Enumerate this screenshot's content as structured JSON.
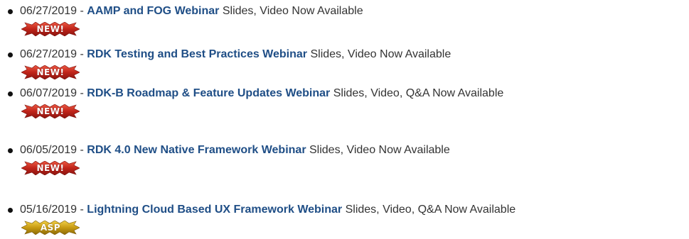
{
  "colors": {
    "link": "#1f4e86",
    "text": "#333333",
    "new_badge": "#c0241a",
    "asp_badge": "#c79a12"
  },
  "items": [
    {
      "date": "06/27/2019",
      "separator": " - ",
      "title": "AAMP and FOG Webinar",
      "suffix": " Slides, Video Now Available",
      "badge": "NEW!",
      "badge_type": "new"
    },
    {
      "date": "06/27/2019",
      "separator": " - ",
      "title": "RDK Testing and Best Practices Webinar",
      "suffix": " Slides, Video Now Available",
      "badge": "NEW!",
      "badge_type": "new"
    },
    {
      "date": "06/07/2019",
      "separator": " - ",
      "title": "RDK-B Roadmap & Feature Updates Webinar",
      "suffix": " Slides, Video, Q&A Now Available",
      "badge": "NEW!",
      "badge_type": "new"
    },
    {
      "date": "06/05/2019",
      "separator": " - ",
      "title": "RDK 4.0 New Native Framework Webinar",
      "suffix": " Slides, Video Now Available",
      "badge": "NEW!",
      "badge_type": "new"
    },
    {
      "date": "05/16/2019",
      "separator": " - ",
      "title": "Lightning Cloud Based UX Framework Webinar",
      "suffix": " Slides, Video, Q&A Now Available",
      "badge": "ASP",
      "badge_type": "asp"
    }
  ]
}
